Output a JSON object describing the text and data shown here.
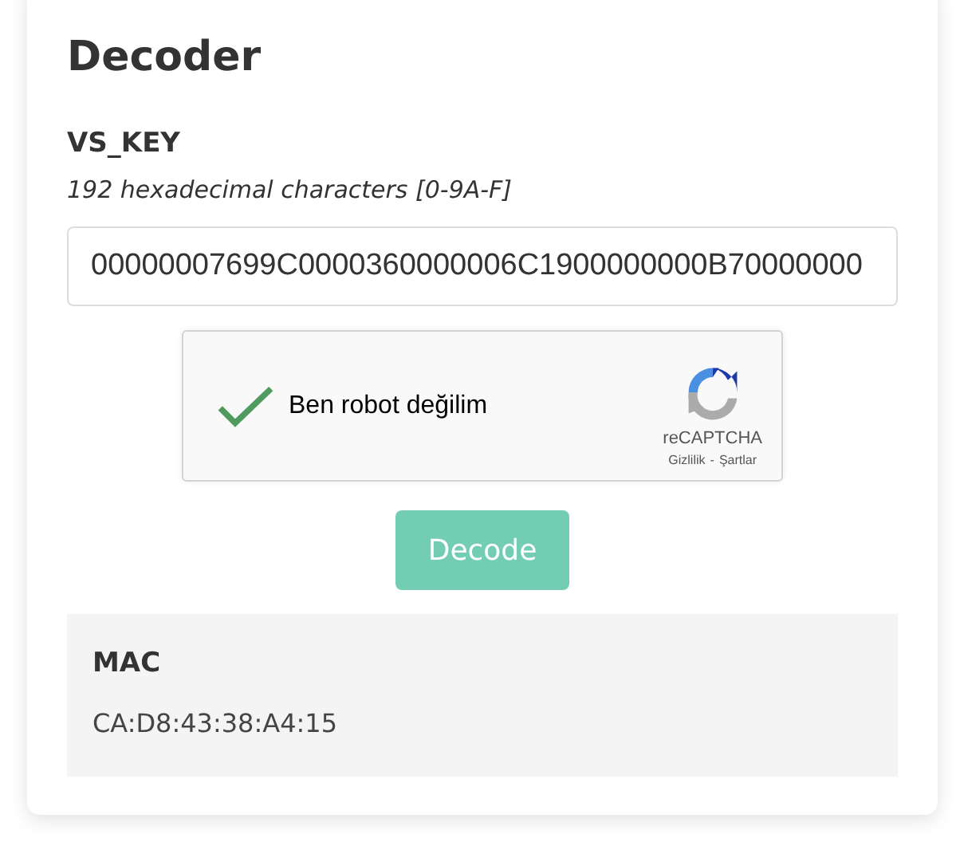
{
  "title": "Decoder",
  "field": {
    "label": "VS_KEY",
    "hint": "192 hexadecimal characters [0-9A-F]",
    "value": "00000007699C0000360000006C1900000000B70000000"
  },
  "captcha": {
    "label": "Ben robot değilim",
    "checked": true,
    "brand": "reCAPTCHA",
    "privacy": "Gizlilik",
    "separator": "-",
    "terms": "Şartlar"
  },
  "button": {
    "label": "Decode",
    "disabled": true
  },
  "result": {
    "label": "MAC",
    "value": "CA:D8:43:38:A4:15"
  }
}
